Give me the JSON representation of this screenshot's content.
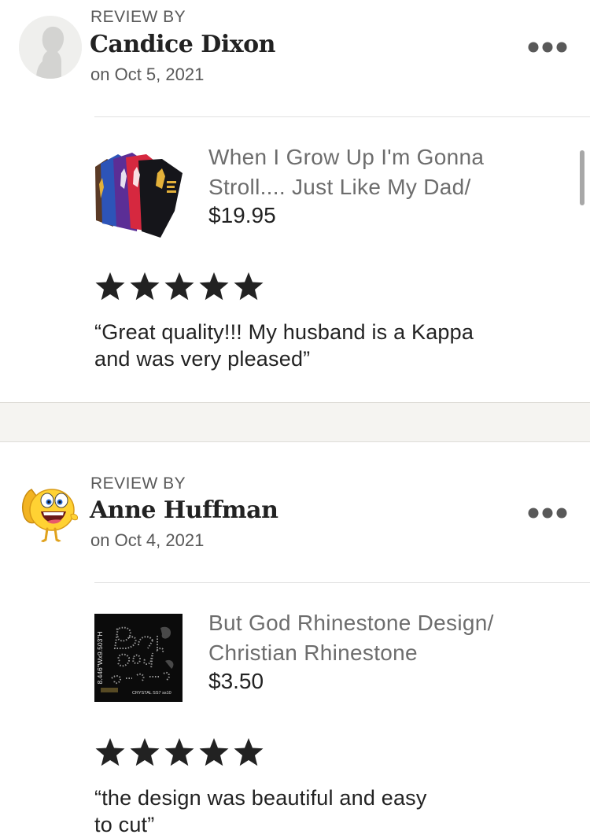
{
  "reviews": [
    {
      "label": "REVIEW BY",
      "reviewer": "Candice Dixon",
      "date": "on Oct 5, 2021",
      "product_title_line1": "When I Grow Up I'm Gonna",
      "product_title_line2": "Stroll....  Just Like My Dad/",
      "price": "$19.95",
      "rating": 5,
      "text_line1": "“Great quality!!! My husband is a Kappa",
      "text_line2": "and was very pleased”",
      "avatar_icon": "default-user-silhouette-icon",
      "more_icon": "more-options-icon"
    },
    {
      "label": "REVIEW BY",
      "reviewer": "Anne Huffman",
      "date": "on Oct 4, 2021",
      "product_title_line1": "But God Rhinestone Design/",
      "product_title_line2": "Christian Rhinestone",
      "price": "$3.50",
      "rating": 5,
      "text_line1": "“the design was beautiful and easy",
      "text_line2": "to cut”",
      "avatar_icon": "emoji-character-icon",
      "more_icon": "more-options-icon",
      "product_image_text": {
        "side_label": "8.446\"Wx9.503\"H",
        "footer": "CRYSTAL SS7 ss10"
      }
    }
  ],
  "colors": {
    "star": "#222222",
    "section_gap": "#f5f4f1",
    "muted_text": "#595959",
    "product_title": "#6d6d6d"
  }
}
